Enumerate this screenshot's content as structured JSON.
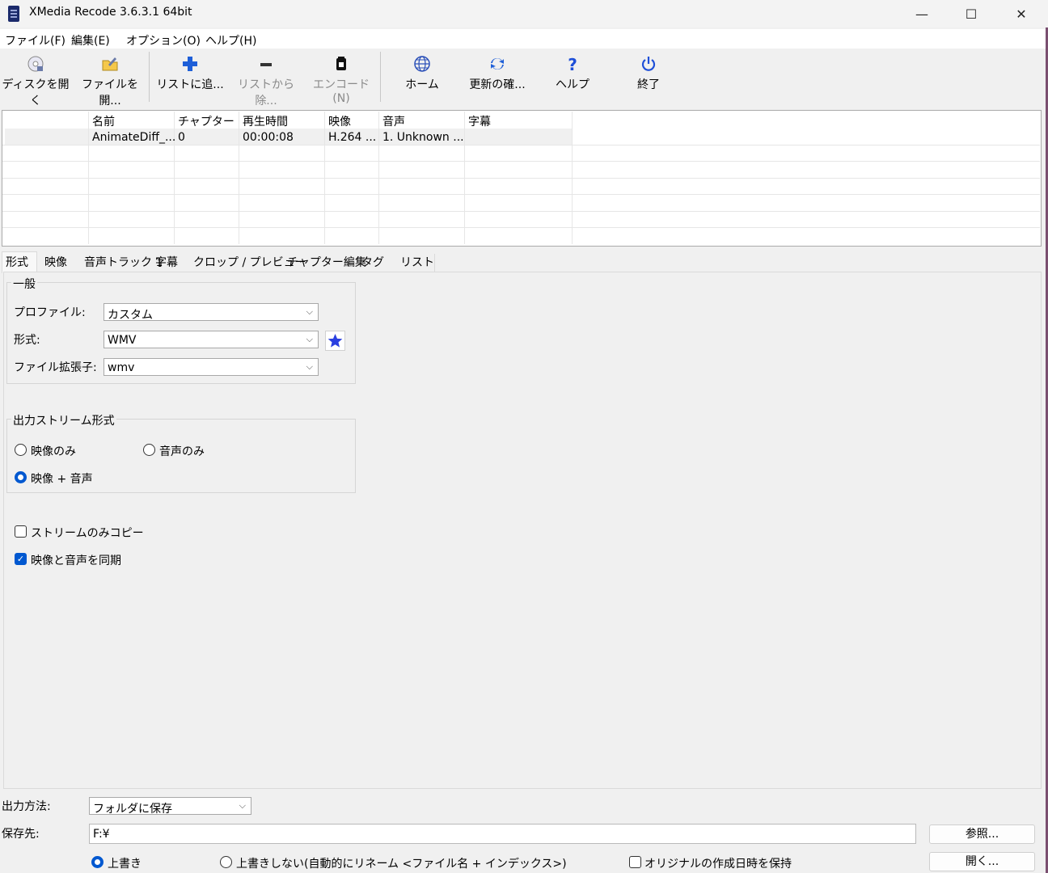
{
  "window": {
    "title": "XMedia Recode 3.6.3.1 64bit",
    "minimize": "—",
    "maximize": "☐",
    "close": "✕"
  },
  "menu": [
    "ファイル(F)",
    "編集(E)",
    "オプション(O)",
    "ヘルプ(H)"
  ],
  "toolbar": {
    "open_disc": "ディスクを開く",
    "open_file": "ファイルを開...",
    "add_list": "リストに追...",
    "remove_list": "リストから除...",
    "encode": "エンコード(N)",
    "home": "ホーム",
    "update": "更新の確...",
    "help": "ヘルプ",
    "exit": "終了"
  },
  "file_list": {
    "columns": [
      "名前",
      "チャプター",
      "再生時間",
      "映像",
      "音声",
      "字幕"
    ],
    "rows": [
      {
        "name": "AnimateDiff_...",
        "chapter": "0",
        "duration": "00:00:08",
        "video": "H.264 ...",
        "audio": "1. Unknown ...",
        "subtitle": ""
      }
    ]
  },
  "tabs": [
    "形式",
    "映像",
    "音声トラック 1",
    "字幕",
    "クロップ / プレビュー",
    "チャプター編集",
    "タグ",
    "リスト"
  ],
  "general": {
    "group_title": "一般",
    "profile_label": "プロファイル:",
    "profile_value": "カスタム",
    "format_label": "形式:",
    "format_value": "WMV",
    "ext_label": "ファイル拡張子:",
    "ext_value": "wmv"
  },
  "output_stream": {
    "group_title": "出力ストリーム形式",
    "video_only": "映像のみ",
    "audio_only": "音声のみ",
    "video_audio": "映像 + 音声",
    "selected": "映像 + 音声"
  },
  "options": {
    "stream_copy": "ストリームのみコピー",
    "stream_copy_checked": false,
    "sync": "映像と音声を同期",
    "sync_checked": true
  },
  "output": {
    "method_label": "出力方法:",
    "method_value": "フォルダに保存",
    "dest_label": "保存先:",
    "dest_value": "F:¥",
    "browse": "参照...",
    "open": "開く...",
    "overwrite": "上書き",
    "no_overwrite": "上書きしない(自動的にリネーム <ファイル名 + インデックス>)",
    "keep_date": "オリジナルの作成日時を保持",
    "overwrite_selected": "上書き",
    "keep_date_checked": false
  },
  "colors": {
    "accent": "#0058d0",
    "star": "#2a3fe0",
    "add": "#1e5fd8",
    "update": "#1e5fd8"
  }
}
